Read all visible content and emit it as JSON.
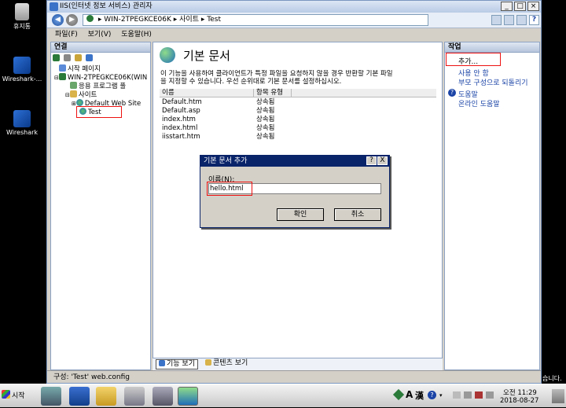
{
  "desktop": {
    "icons": [
      {
        "label": "휴지통"
      },
      {
        "label": "Wireshark-..."
      },
      {
        "label": "Wireshark"
      }
    ],
    "right_edge_text": "습니다."
  },
  "window": {
    "title": "IIS(인터넷 정보 서비스) 관리자",
    "address": {
      "segments": [
        "WIN-2TPEGKCE06K",
        "사이트",
        "Test"
      ],
      "separator": "▸"
    },
    "menu": [
      "파일(F)",
      "보기(V)",
      "도움말(H)"
    ]
  },
  "connections": {
    "header": "연결",
    "tree": [
      {
        "label": "시작 페이지"
      },
      {
        "label": "WIN-2TPEGKCE06K(WIN"
      },
      {
        "label": "응용 프로그램 풀"
      },
      {
        "label": "사이트"
      },
      {
        "label": "Default Web Site"
      },
      {
        "label": "Test"
      }
    ]
  },
  "content": {
    "title": "기본 문서",
    "description_line1": "이 기능을 사용하여 클라이언트가 특정 파일을 요청하지 않을 경우 반환할 기본 파일",
    "description_line2": "을 지정할 수 있습니다. 우선 순위대로 기본 문서를 설정하십시오.",
    "columns": [
      "이름",
      "항목 유형"
    ],
    "rows": [
      {
        "name": "Default.htm",
        "type": "상속됨"
      },
      {
        "name": "Default.asp",
        "type": "상속됨"
      },
      {
        "name": "index.htm",
        "type": "상속됨"
      },
      {
        "name": "index.html",
        "type": "상속됨"
      },
      {
        "name": "iisstart.htm",
        "type": "상속됨"
      }
    ],
    "bottom_tabs": [
      "기능 보기",
      "콘텐츠 보기"
    ]
  },
  "actions": {
    "header": "작업",
    "items": [
      "추가...",
      "사용 안 함",
      "부모 구성으로 되돌리기",
      "도움말",
      "온라인 도움말"
    ]
  },
  "status": {
    "text": "구성: 'Test' web.config"
  },
  "dialog": {
    "title": "기본 문서 추가",
    "title_buttons": [
      "?",
      "X"
    ],
    "name_label": "이름(N):",
    "name_value": "hello.html",
    "ok": "확인",
    "cancel": "취소"
  },
  "taskbar": {
    "start": "시작",
    "time": "오전 11:29",
    "date": "2018-08-27",
    "ime_a": "A",
    "ime_han": "漢"
  },
  "colors": {
    "highlight": "#e11111",
    "dialog_title": "#0a246a",
    "link": "#1b44a6"
  }
}
